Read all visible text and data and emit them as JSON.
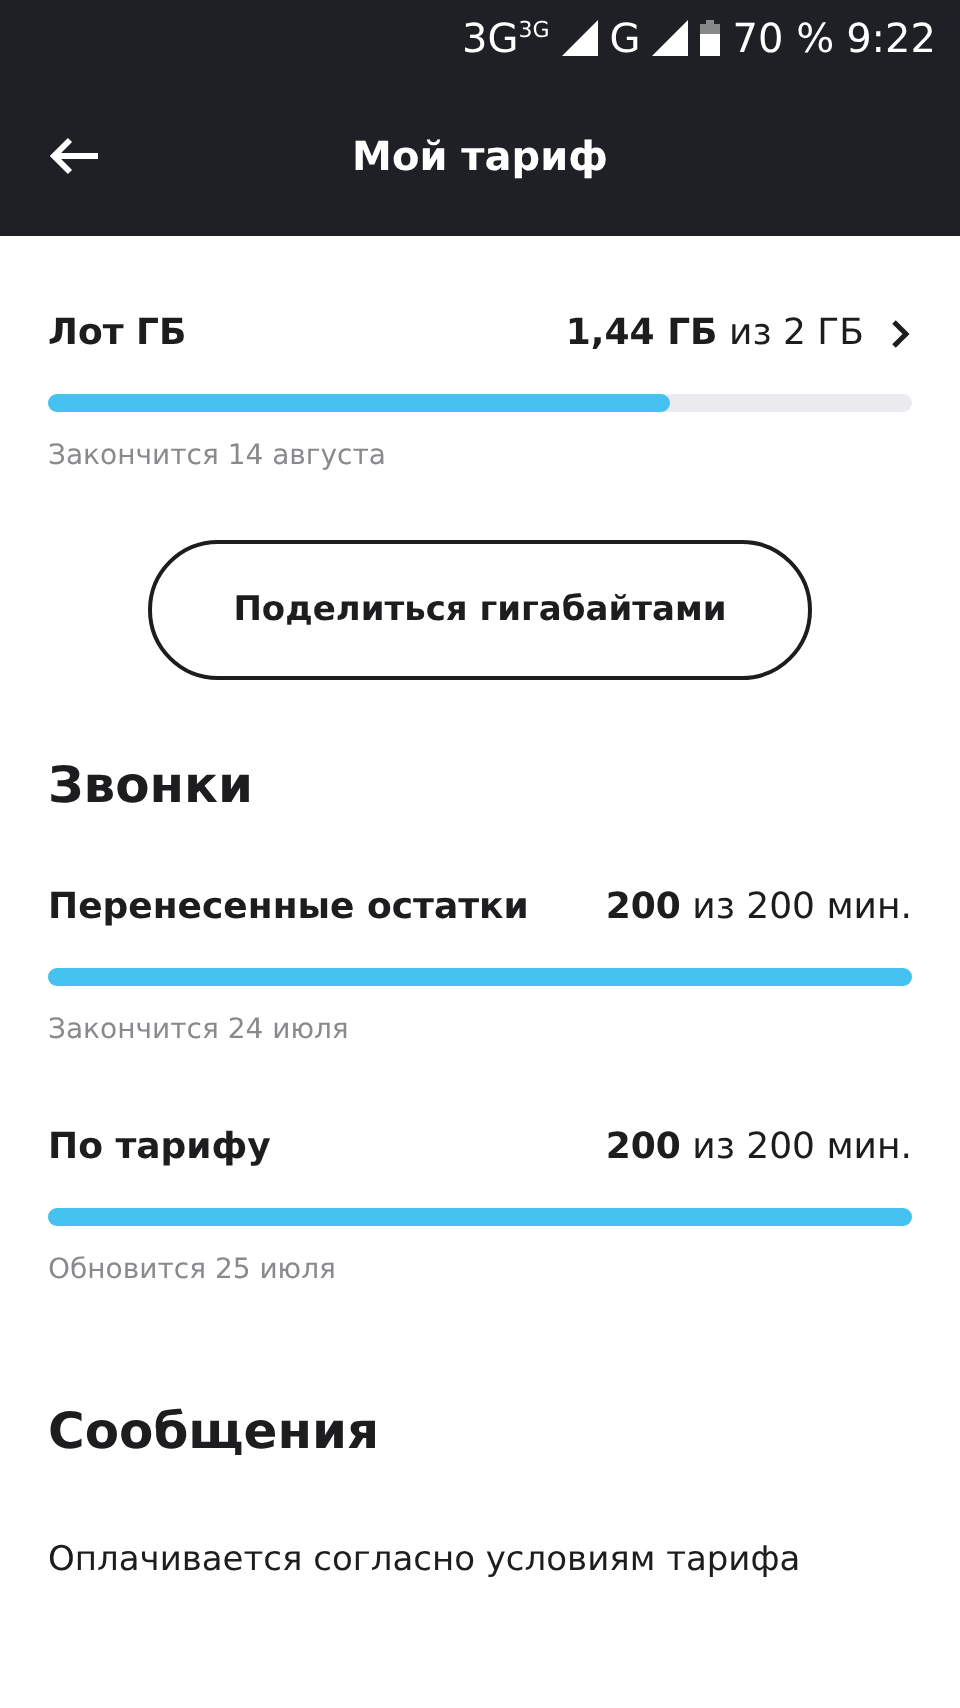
{
  "status_bar": {
    "network_1": "3G",
    "network_1_small": "3G",
    "network_2": "G",
    "battery": "70 %",
    "time": "9:22"
  },
  "header": {
    "title": "Мой тариф"
  },
  "data": {
    "label": "Лот ГБ",
    "value": "**1,44 ГБ** из 2 ГБ",
    "level": 0.72,
    "note": "Закончится 14 августа"
  },
  "share_button": "Поделиться гигабайтами",
  "calls": {
    "heading": "Звонки",
    "items": [
      {
        "label": "Перенесенные остатки",
        "value": "**200** из 200 мин.",
        "level": 1,
        "note": "Закончится 24 июля"
      },
      {
        "label": "По тарифу",
        "value": "**200** из 200 мин.",
        "level": 1,
        "note": "Обновится 25 июля"
      }
    ]
  },
  "messages": {
    "heading": "Сообщения",
    "text": "Оплачивается согласно условиям тарифа"
  }
}
